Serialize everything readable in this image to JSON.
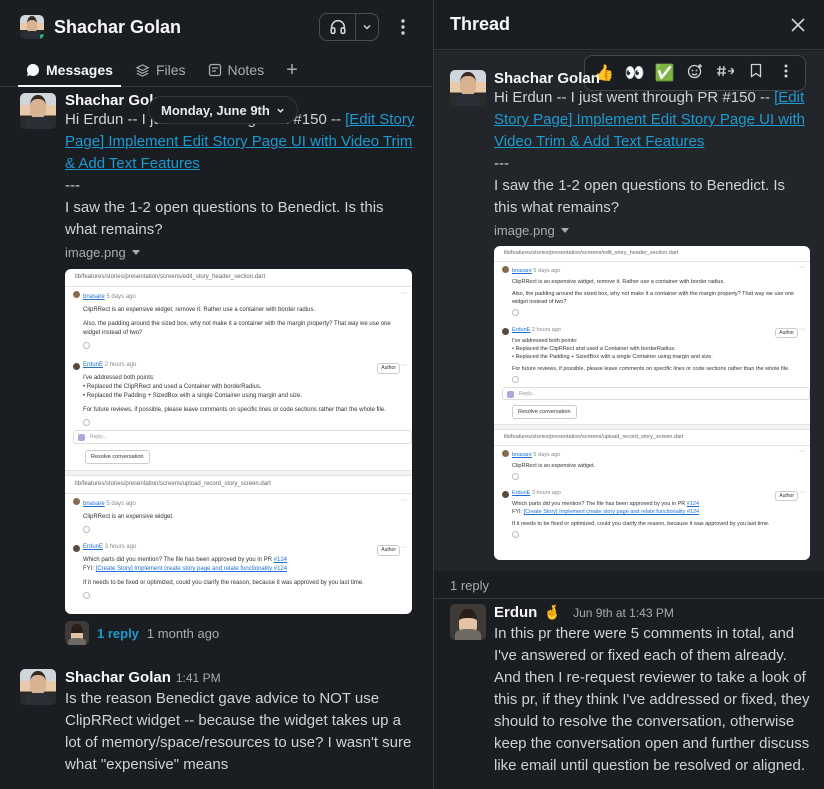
{
  "channel": {
    "name": "Shachar Golan",
    "tabs": [
      {
        "label": "Messages"
      },
      {
        "label": "Files"
      },
      {
        "label": "Notes"
      }
    ]
  },
  "date_divider": "Monday, June 9th",
  "messages": [
    {
      "sender": "Shachar Golan",
      "text_intro": "Hi Erdun -- I just went through PR #150 -- ",
      "link_text": "[Edit Story Page] Implement Edit Story Page UI with Video Trim & Add Text Features",
      "separator": "---",
      "text_outro": "I saw the 1-2 open questions to Benedict. Is this what remains?",
      "attachment": "image.png",
      "reply_count": "1 reply",
      "reply_ago": "1 month ago"
    },
    {
      "sender": "Shachar Golan",
      "time": "1:41 PM",
      "text": "Is the reason Benedict gave advice to NOT use ClipRRect widget -- because the widget takes up a lot of memory/space/resources to use? I wasn't sure what \"expensive\" means"
    }
  ],
  "embedded_image": {
    "file1": "lib/features/stories/presentation/screens/edit_story_header_section.dart",
    "file2": "lib/features/stories/presentation/screens/upload_record_story_screen.dart",
    "c1_user": "bnasare",
    "c1_ago": "5 days ago",
    "c1_l1": "ClipRRect is an expensive widget, remove it. Rather use a container with border radius.",
    "c1_l2": "Also, the padding around the sized box, why not make it a container with the margin property? That way we use one widget instead of two?",
    "c2_user": "ErdunE",
    "c2_ago": "2 hours ago",
    "badge": "Author",
    "c2_l1": "I've addressed both points:",
    "c2_l2": "• Replaced the ClipRRect and used a Container with borderRadius.",
    "c2_l3": "• Replaced the Padding + SizedBox with a single Container using margin and size.",
    "c2_l4": "For future reviews, if possible, please leave comments on specific lines or code sections rather than the whole file.",
    "reply_placeholder": "Reply...",
    "resolve": "Resolve conversation",
    "c3_user": "bnasare",
    "c3_ago": "5 days ago",
    "c3_l1": "ClipRRect is an expensive widget.",
    "c4_user": "ErdunE",
    "c4_ago": "3 hours ago",
    "c4_l1a": "Which parts did you mention? The file has been approved by you in PR ",
    "c4_l1b": "#124",
    "c4_l2a": "FYI: ",
    "c4_l2b": "[Create Story] Implement create story page and relate functionality #124",
    "c4_l3": "If it needs to be fixed or optimized, could you clarify the reason, because it was approved by you last time."
  },
  "thread": {
    "title": "Thread",
    "reactions": [
      "👍",
      "👀",
      "✅"
    ],
    "reply_count": "1 reply",
    "reply": {
      "sender": "Erdun",
      "status_emoji": "🤞",
      "time": "Jun 9th at 1:43 PM",
      "text": "In this pr there were 5 comments in total, and I've answered or fixed each of them already. And then I re-request reviewer to take a look of this pr, if they think I've addressed or fixed, they should to resolve the conversation, otherwise keep the conversation open and further discuss like email until question be resolved or aligned."
    }
  },
  "colors": {
    "background": "#1a1d21",
    "link": "#1d9bd1",
    "presence": "#2bac76"
  }
}
